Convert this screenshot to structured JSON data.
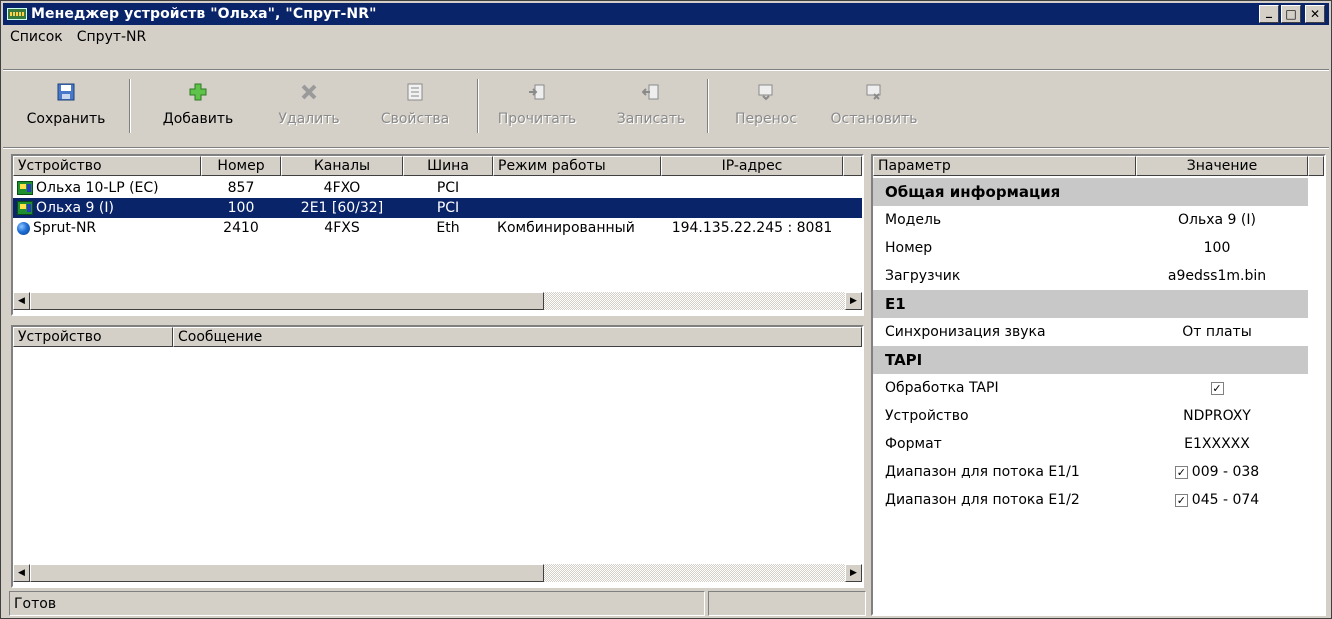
{
  "window": {
    "title": "Менеджер устройств \"Ольха\", \"Спрут-NR\"",
    "controls": {
      "minimize": "_",
      "maximize": "□",
      "close": "✕"
    }
  },
  "menu": [
    "Список",
    "Спрут-NR"
  ],
  "toolbar": {
    "save": "Сохранить",
    "add": "Добавить",
    "delete": "Удалить",
    "properties": "Свойства",
    "read": "Прочитать",
    "write": "Записать",
    "transfer": "Перенос",
    "stop": "Остановить"
  },
  "devices": {
    "columns": [
      "Устройство",
      "Номер",
      "Каналы",
      "Шина",
      "Режим работы",
      "IP-адрес"
    ],
    "rows": [
      {
        "name": "Ольха 10-LP (EC)",
        "number": "857",
        "channels": "4FXO",
        "bus": "PCI",
        "mode": "",
        "ip": "",
        "icon": "board-icon"
      },
      {
        "name": "Ольха 9 (I)",
        "number": "100",
        "channels": "2E1 [60/32]",
        "bus": "PCI",
        "mode": "",
        "ip": "",
        "icon": "board-icon",
        "selected": true
      },
      {
        "name": "Sprut-NR",
        "number": "2410",
        "channels": "4FXS",
        "bus": "Eth",
        "mode": "Комбинированный",
        "ip": "194.135.22.245 : 8081",
        "icon": "globe-icon"
      }
    ]
  },
  "messages": {
    "columns": [
      "Устройство",
      "Сообщение"
    ]
  },
  "status": {
    "text": "Готов"
  },
  "properties": {
    "columns": [
      "Параметр",
      "Значение"
    ],
    "groups": [
      {
        "title": "Общая информация",
        "items": [
          {
            "name": "Модель",
            "value": "Ольха 9 (I)"
          },
          {
            "name": "Номер",
            "value": "100"
          },
          {
            "name": "Загрузчик",
            "value": "a9edss1m.bin"
          }
        ]
      },
      {
        "title": "E1",
        "items": [
          {
            "name": "Синхронизация звука",
            "value": "От платы"
          }
        ]
      },
      {
        "title": "TAPI",
        "items": [
          {
            "name": "Обработка TAPI",
            "value": "",
            "checked": true
          },
          {
            "name": "Устройство",
            "value": "NDPROXY"
          },
          {
            "name": "Формат",
            "value": "E1XXXXX"
          },
          {
            "name": "Диапазон для потока E1/1",
            "value": "009 - 038",
            "checked": true
          },
          {
            "name": "Диапазон для потока E1/2",
            "value": "045 - 074",
            "checked": true
          }
        ]
      }
    ]
  }
}
